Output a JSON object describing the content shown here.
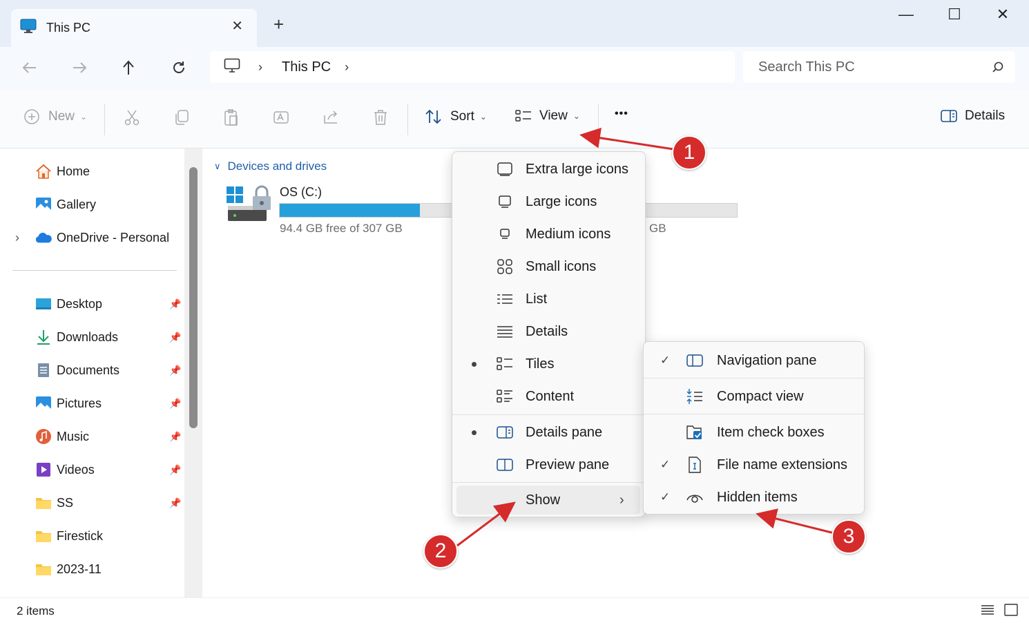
{
  "window": {
    "tab_title": "This PC",
    "new_tab_symbol": "+",
    "close_tab_symbol": "✕",
    "minimize_symbol": "—",
    "maximize_symbol": "☐",
    "close_symbol": "✕"
  },
  "address": {
    "crumb": "This PC",
    "search_placeholder": "Search This PC"
  },
  "commandbar": {
    "new_label": "New",
    "sort_label": "Sort",
    "view_label": "View",
    "more_symbol": "•••",
    "details_label": "Details",
    "icons": [
      "cut-icon",
      "copy-icon",
      "paste-icon",
      "rename-icon",
      "share-icon",
      "delete-icon"
    ]
  },
  "navpane": {
    "top": [
      "Home",
      "Gallery",
      "OneDrive - Personal"
    ],
    "pinned": [
      "Desktop",
      "Downloads",
      "Documents",
      "Pictures",
      "Music",
      "Videos",
      "SS",
      "Firestick",
      "2023-11"
    ]
  },
  "content": {
    "group_label": "Devices and drives",
    "drive_name": "OS (C:)",
    "drive_free": "94.4 GB free of 307 GB",
    "drive_free_fragment": "GB",
    "drive_used_fraction": 0.307
  },
  "view_menu": {
    "items": [
      "Extra large icons",
      "Large icons",
      "Medium icons",
      "Small icons",
      "List",
      "Details",
      "Tiles",
      "Content"
    ],
    "panes": [
      "Details pane",
      "Preview pane"
    ],
    "show_label": "Show"
  },
  "show_menu": {
    "items": [
      "Navigation pane",
      "Compact view",
      "Item check boxes",
      "File name extensions",
      "Hidden items"
    ]
  },
  "status": {
    "count": "2 items"
  },
  "callouts": [
    "1",
    "2",
    "3"
  ],
  "colors": {
    "accent": "#0067c0",
    "drive_fill": "#26a0da",
    "callout": "#d52b2b"
  }
}
